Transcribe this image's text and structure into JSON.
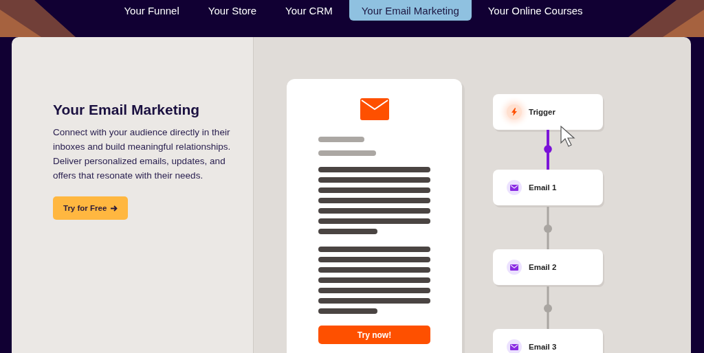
{
  "tabs": [
    {
      "label": "Your Funnel",
      "selected": false
    },
    {
      "label": "Your Store",
      "selected": false
    },
    {
      "label": "Your CRM",
      "selected": false
    },
    {
      "label": "Your Email Marketing",
      "selected": true
    },
    {
      "label": "Your Online Courses",
      "selected": false
    }
  ],
  "intro": {
    "heading": "Your Email Marketing",
    "body": "Connect with your audience directly in their inboxes and build meaningful relationships. Deliver personalized emails, updates, and offers that resonate with their needs.",
    "button": "Try for Free"
  },
  "email_preview": {
    "button": "Try now!"
  },
  "flow": [
    {
      "kind": "trigger",
      "label": "Trigger"
    },
    {
      "kind": "email",
      "label": "Email 1"
    },
    {
      "kind": "email",
      "label": "Email 2"
    },
    {
      "kind": "email",
      "label": "Email 3"
    }
  ]
}
